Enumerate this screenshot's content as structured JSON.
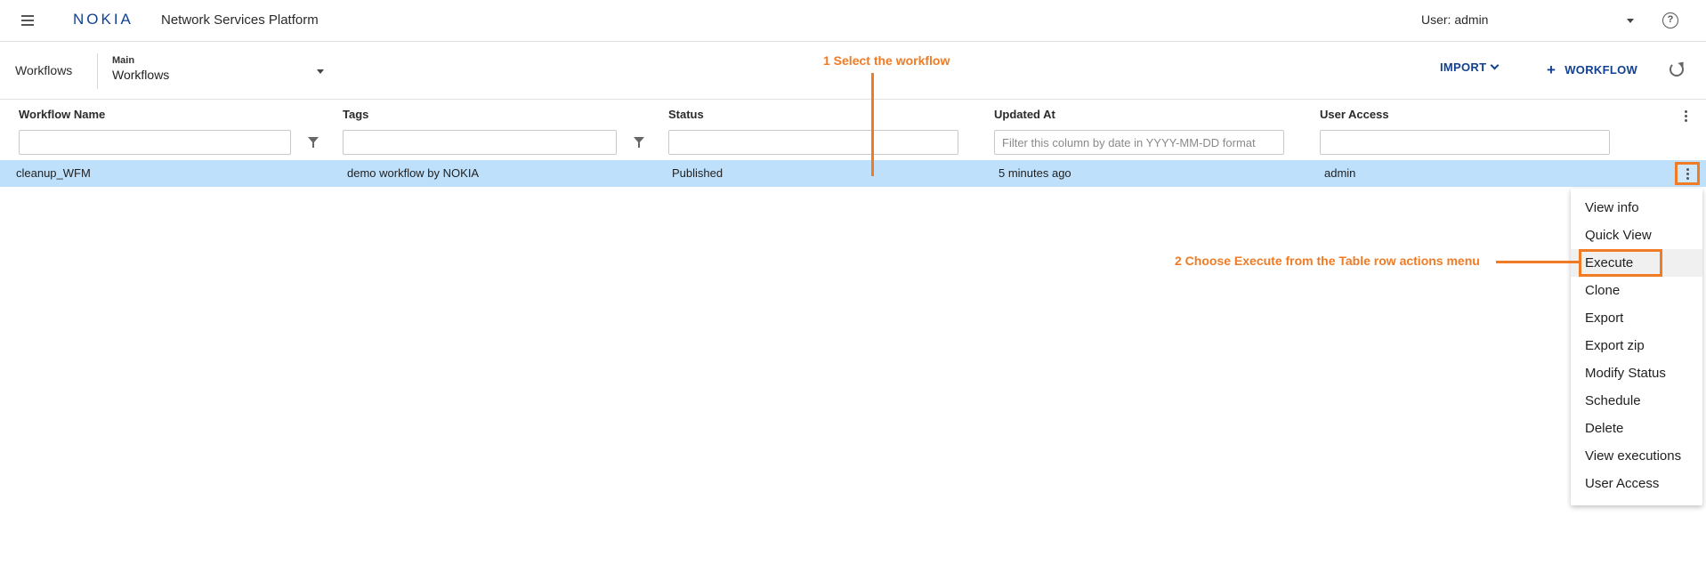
{
  "app": {
    "logo": "NOKIA",
    "title": "Network Services Platform",
    "user_label": "User: admin"
  },
  "toolbar": {
    "breadcrumb": "Workflows",
    "selector_label": "Main",
    "selector_value": "Workflows",
    "import_label": "IMPORT",
    "workflow_label": "WORKFLOW"
  },
  "table": {
    "columns": [
      {
        "title": "Workflow Name",
        "filter_placeholder": ""
      },
      {
        "title": "Tags",
        "filter_placeholder": ""
      },
      {
        "title": "Status",
        "filter_placeholder": ""
      },
      {
        "title": "Updated At",
        "filter_placeholder": "Filter this column by date in YYYY-MM-DD format"
      },
      {
        "title": "User Access",
        "filter_placeholder": ""
      }
    ],
    "rows": [
      {
        "name": "cleanup_WFM",
        "tags": "demo workflow by NOKIA",
        "status": "Published",
        "updated": "5 minutes ago",
        "access": "admin"
      }
    ]
  },
  "menu": {
    "items": [
      "View info",
      "Quick View",
      "Execute",
      "Clone",
      "Export",
      "Export zip",
      "Modify Status",
      "Schedule",
      "Delete",
      "View executions",
      "User Access"
    ]
  },
  "annotations": {
    "step1": "1 Select the workflow",
    "step2": "2 Choose Execute from the Table row actions menu",
    "color": "#f07b24"
  },
  "colors": {
    "brand": "#124191",
    "selected_row": "#bfe0fa"
  }
}
